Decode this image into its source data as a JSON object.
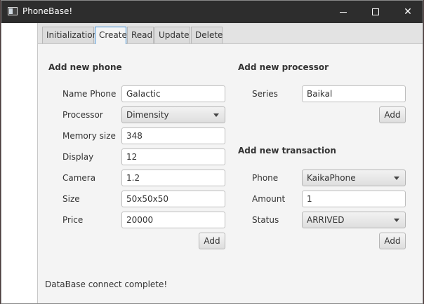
{
  "window": {
    "title": "PhoneBase!"
  },
  "tabs": [
    "Initialization",
    "Create",
    "Read",
    "Update",
    "Delete"
  ],
  "phone_section": {
    "title": "Add new phone",
    "fields": {
      "name": {
        "label": "Name Phone",
        "value": "Galactic"
      },
      "processor": {
        "label": "Processor",
        "value": "Dimensity"
      },
      "memory": {
        "label": "Memory size",
        "value": "348"
      },
      "display": {
        "label": "Display",
        "value": "12"
      },
      "camera": {
        "label": "Camera",
        "value": "1.2"
      },
      "size": {
        "label": "Size",
        "value": "50x50x50"
      },
      "price": {
        "label": "Price",
        "value": "20000"
      }
    },
    "add_label": "Add"
  },
  "processor_section": {
    "title": "Add new processor",
    "series": {
      "label": "Series",
      "value": "Baikal"
    },
    "add_label": "Add"
  },
  "transaction_section": {
    "title": "Add new transaction",
    "phone": {
      "label": "Phone",
      "value": "KaikaPhone"
    },
    "amount": {
      "label": "Amount",
      "value": "1"
    },
    "status": {
      "label": "Status",
      "value": "ARRIVED"
    },
    "add_label": "Add"
  },
  "status_text": "DataBase connect complete!"
}
